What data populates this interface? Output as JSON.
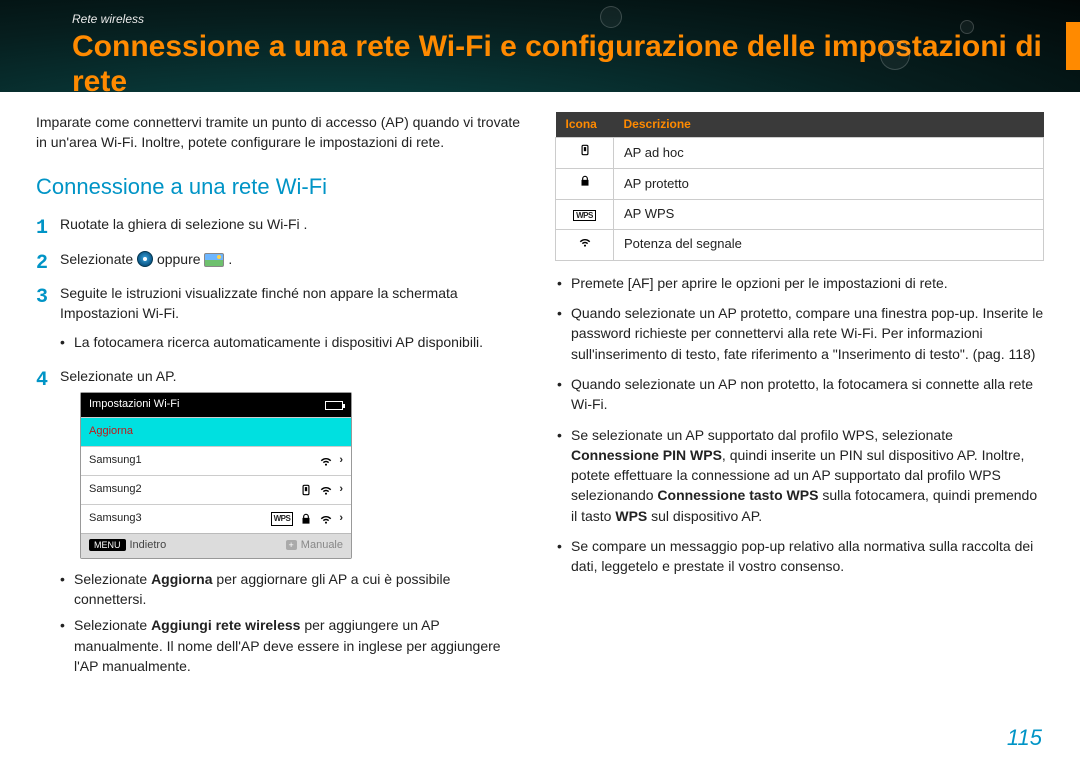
{
  "header": {
    "breadcrumb": "Rete wireless",
    "title": "Connessione a una rete Wi-Fi e configurazione delle impostazioni di rete"
  },
  "left": {
    "intro": "Imparate come connettervi tramite un punto di accesso (AP) quando vi trovate in un'area Wi-Fi. Inoltre, potete configurare le impostazioni di rete.",
    "section_title": "Connessione a una rete Wi-Fi",
    "step1": "Ruotate la ghiera di selezione su Wi-Fi .",
    "step2_a": "Selezionate ",
    "step2_mid": " oppure ",
    "step2_b": " .",
    "step3": "Seguite le istruzioni visualizzate finché non appare la schermata Impostazioni Wi-Fi.",
    "step3_sub": "La fotocamera ricerca automaticamente i dispositivi AP disponibili.",
    "step4": "Selezionate un AP.",
    "ss": {
      "title": "Impostazioni Wi-Fi",
      "refresh": "Aggiorna",
      "ap1": "Samsung1",
      "ap2": "Samsung2",
      "ap3": "Samsung3",
      "back": "Indietro",
      "menu_chip": "MENU",
      "manual": "Manuale"
    },
    "bullet_a_pre": "Selezionate ",
    "bullet_a_bold": "Aggiorna",
    "bullet_a_post": " per aggiornare gli AP a cui è possibile connettersi.",
    "bullet_b_pre": "Selezionate ",
    "bullet_b_bold": "Aggiungi rete wireless",
    "bullet_b_post": " per aggiungere un AP manualmente. Il nome dell'AP deve essere in inglese per aggiungere l'AP manualmente."
  },
  "right": {
    "th_icon": "Icona",
    "th_desc": "Descrizione",
    "rows": {
      "adhoc": "AP ad hoc",
      "protected": "AP protetto",
      "wps": "AP WPS",
      "signal": "Potenza del segnale"
    },
    "b1_pre": "Premete [",
    "b1_af": "AF",
    "b1_post": "] per aprire le opzioni per le impostazioni di rete.",
    "b2": "Quando selezionate un AP protetto, compare una finestra pop-up. Inserite le password richieste per connettervi alla rete Wi-Fi. Per informazioni sull'inserimento di testo, fate riferimento a \"Inserimento di testo\". (pag. 118)",
    "b3": "Quando selezionate un AP non protetto, la fotocamera si connette alla rete Wi-Fi.",
    "b4_pre": "Se selezionate un AP supportato dal profilo WPS, selezionate ",
    "b4_bold1": "Connessione PIN WPS",
    "b4_mid1": ", quindi inserite un PIN sul dispositivo AP. Inoltre, potete effettuare la connessione ad un AP supportato dal profilo WPS selezionando ",
    "b4_bold2": "Connessione tasto WPS",
    "b4_mid2": " sulla fotocamera, quindi premendo il tasto ",
    "b4_bold3": "WPS",
    "b4_post": " sul dispositivo AP.",
    "b5": "Se compare un messaggio pop-up relativo alla normativa sulla raccolta dei dati, leggetelo e prestate il vostro consenso."
  },
  "page_number": "115"
}
